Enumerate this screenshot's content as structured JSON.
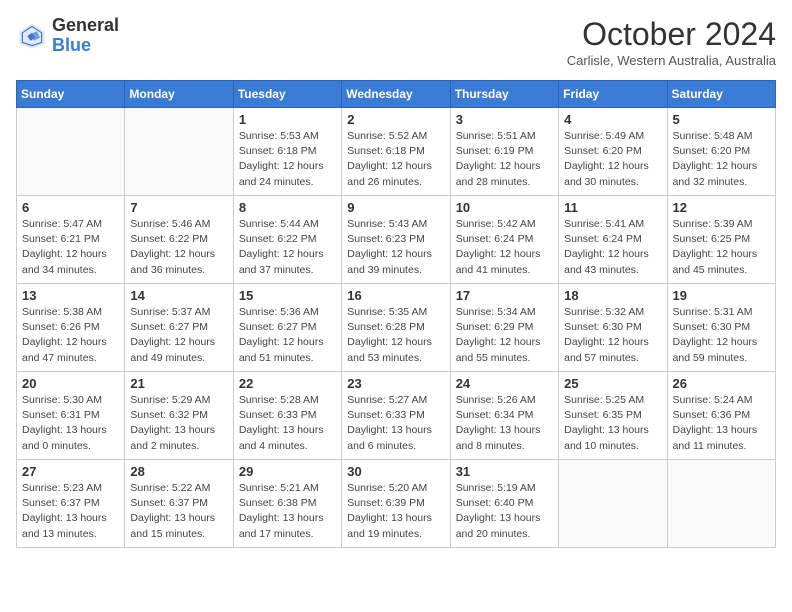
{
  "header": {
    "logo_general": "General",
    "logo_blue": "Blue",
    "month_title": "October 2024",
    "location": "Carlisle, Western Australia, Australia"
  },
  "days_of_week": [
    "Sunday",
    "Monday",
    "Tuesday",
    "Wednesday",
    "Thursday",
    "Friday",
    "Saturday"
  ],
  "weeks": [
    [
      {
        "day": "",
        "info": ""
      },
      {
        "day": "",
        "info": ""
      },
      {
        "day": "1",
        "info": "Sunrise: 5:53 AM\nSunset: 6:18 PM\nDaylight: 12 hours and 24 minutes."
      },
      {
        "day": "2",
        "info": "Sunrise: 5:52 AM\nSunset: 6:18 PM\nDaylight: 12 hours and 26 minutes."
      },
      {
        "day": "3",
        "info": "Sunrise: 5:51 AM\nSunset: 6:19 PM\nDaylight: 12 hours and 28 minutes."
      },
      {
        "day": "4",
        "info": "Sunrise: 5:49 AM\nSunset: 6:20 PM\nDaylight: 12 hours and 30 minutes."
      },
      {
        "day": "5",
        "info": "Sunrise: 5:48 AM\nSunset: 6:20 PM\nDaylight: 12 hours and 32 minutes."
      }
    ],
    [
      {
        "day": "6",
        "info": "Sunrise: 5:47 AM\nSunset: 6:21 PM\nDaylight: 12 hours and 34 minutes."
      },
      {
        "day": "7",
        "info": "Sunrise: 5:46 AM\nSunset: 6:22 PM\nDaylight: 12 hours and 36 minutes."
      },
      {
        "day": "8",
        "info": "Sunrise: 5:44 AM\nSunset: 6:22 PM\nDaylight: 12 hours and 37 minutes."
      },
      {
        "day": "9",
        "info": "Sunrise: 5:43 AM\nSunset: 6:23 PM\nDaylight: 12 hours and 39 minutes."
      },
      {
        "day": "10",
        "info": "Sunrise: 5:42 AM\nSunset: 6:24 PM\nDaylight: 12 hours and 41 minutes."
      },
      {
        "day": "11",
        "info": "Sunrise: 5:41 AM\nSunset: 6:24 PM\nDaylight: 12 hours and 43 minutes."
      },
      {
        "day": "12",
        "info": "Sunrise: 5:39 AM\nSunset: 6:25 PM\nDaylight: 12 hours and 45 minutes."
      }
    ],
    [
      {
        "day": "13",
        "info": "Sunrise: 5:38 AM\nSunset: 6:26 PM\nDaylight: 12 hours and 47 minutes."
      },
      {
        "day": "14",
        "info": "Sunrise: 5:37 AM\nSunset: 6:27 PM\nDaylight: 12 hours and 49 minutes."
      },
      {
        "day": "15",
        "info": "Sunrise: 5:36 AM\nSunset: 6:27 PM\nDaylight: 12 hours and 51 minutes."
      },
      {
        "day": "16",
        "info": "Sunrise: 5:35 AM\nSunset: 6:28 PM\nDaylight: 12 hours and 53 minutes."
      },
      {
        "day": "17",
        "info": "Sunrise: 5:34 AM\nSunset: 6:29 PM\nDaylight: 12 hours and 55 minutes."
      },
      {
        "day": "18",
        "info": "Sunrise: 5:32 AM\nSunset: 6:30 PM\nDaylight: 12 hours and 57 minutes."
      },
      {
        "day": "19",
        "info": "Sunrise: 5:31 AM\nSunset: 6:30 PM\nDaylight: 12 hours and 59 minutes."
      }
    ],
    [
      {
        "day": "20",
        "info": "Sunrise: 5:30 AM\nSunset: 6:31 PM\nDaylight: 13 hours and 0 minutes."
      },
      {
        "day": "21",
        "info": "Sunrise: 5:29 AM\nSunset: 6:32 PM\nDaylight: 13 hours and 2 minutes."
      },
      {
        "day": "22",
        "info": "Sunrise: 5:28 AM\nSunset: 6:33 PM\nDaylight: 13 hours and 4 minutes."
      },
      {
        "day": "23",
        "info": "Sunrise: 5:27 AM\nSunset: 6:33 PM\nDaylight: 13 hours and 6 minutes."
      },
      {
        "day": "24",
        "info": "Sunrise: 5:26 AM\nSunset: 6:34 PM\nDaylight: 13 hours and 8 minutes."
      },
      {
        "day": "25",
        "info": "Sunrise: 5:25 AM\nSunset: 6:35 PM\nDaylight: 13 hours and 10 minutes."
      },
      {
        "day": "26",
        "info": "Sunrise: 5:24 AM\nSunset: 6:36 PM\nDaylight: 13 hours and 11 minutes."
      }
    ],
    [
      {
        "day": "27",
        "info": "Sunrise: 5:23 AM\nSunset: 6:37 PM\nDaylight: 13 hours and 13 minutes."
      },
      {
        "day": "28",
        "info": "Sunrise: 5:22 AM\nSunset: 6:37 PM\nDaylight: 13 hours and 15 minutes."
      },
      {
        "day": "29",
        "info": "Sunrise: 5:21 AM\nSunset: 6:38 PM\nDaylight: 13 hours and 17 minutes."
      },
      {
        "day": "30",
        "info": "Sunrise: 5:20 AM\nSunset: 6:39 PM\nDaylight: 13 hours and 19 minutes."
      },
      {
        "day": "31",
        "info": "Sunrise: 5:19 AM\nSunset: 6:40 PM\nDaylight: 13 hours and 20 minutes."
      },
      {
        "day": "",
        "info": ""
      },
      {
        "day": "",
        "info": ""
      }
    ]
  ]
}
